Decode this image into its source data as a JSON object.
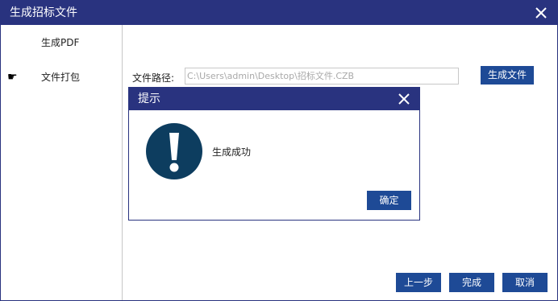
{
  "window": {
    "title": "生成招标文件"
  },
  "sidebar": {
    "items": [
      {
        "label": "生成PDF"
      },
      {
        "label": "文件打包",
        "pointer_icon": "☛"
      }
    ]
  },
  "main": {
    "path_label": "文件路径:",
    "path_value": "C:\\Users\\admin\\Desktop\\招标文件.CZB",
    "generate_label": "生成文件"
  },
  "footer": {
    "prev_label": "上一步",
    "done_label": "完成",
    "cancel_label": "取消"
  },
  "dialog": {
    "title": "提示",
    "message": "生成成功",
    "ok_label": "确定",
    "icon": "exclamation-icon"
  },
  "colors": {
    "titlebar": "#29337f",
    "button": "#1e4a96",
    "alert_icon": "#0d3d5f"
  }
}
